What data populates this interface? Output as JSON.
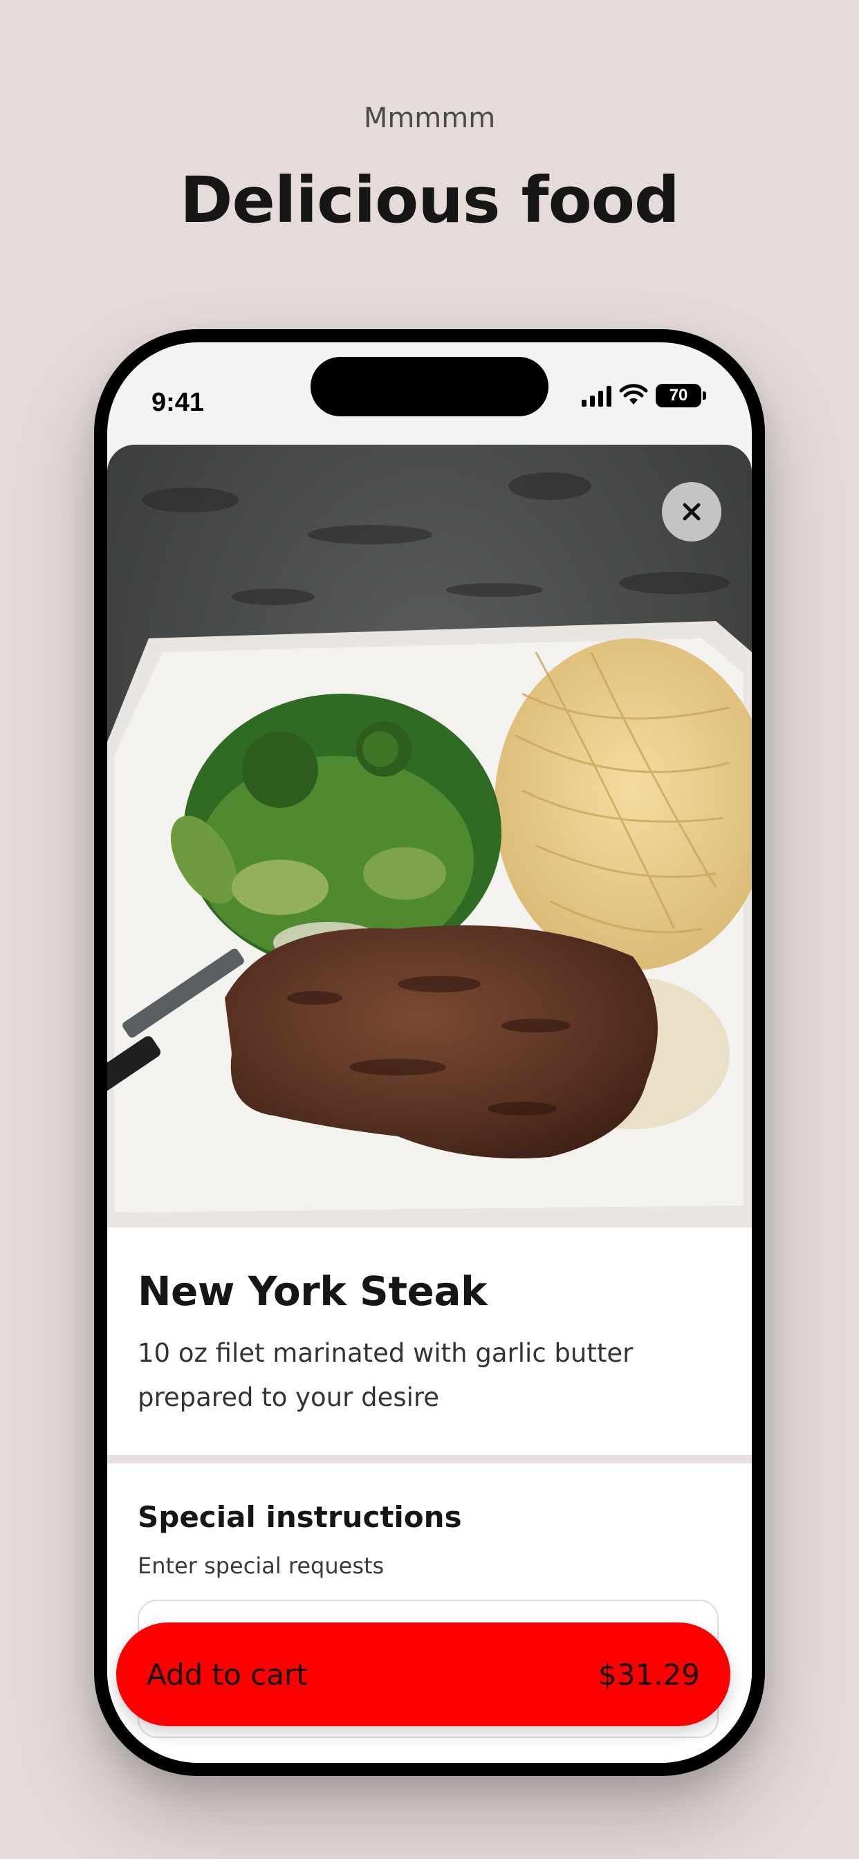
{
  "page": {
    "eyebrow": "Mmmmm",
    "headline": "Delicious food"
  },
  "status_bar": {
    "time": "9:41",
    "battery": "70",
    "icons": [
      "signal-icon",
      "wifi-icon",
      "battery-icon"
    ]
  },
  "item": {
    "title": "New York Steak",
    "description": "10 oz filet marinated with garlic butter prepared to your desire",
    "image": "steak-plate-photo"
  },
  "special_instructions": {
    "title": "Special instructions",
    "subtitle": "Enter special requests",
    "value": ""
  },
  "cta": {
    "label": "Add to cart",
    "price": "$31.29"
  },
  "colors": {
    "background": "#e5dcda",
    "accent": "#ff0000",
    "text": "#161616"
  },
  "controls": {
    "close_icon": "close-icon"
  }
}
